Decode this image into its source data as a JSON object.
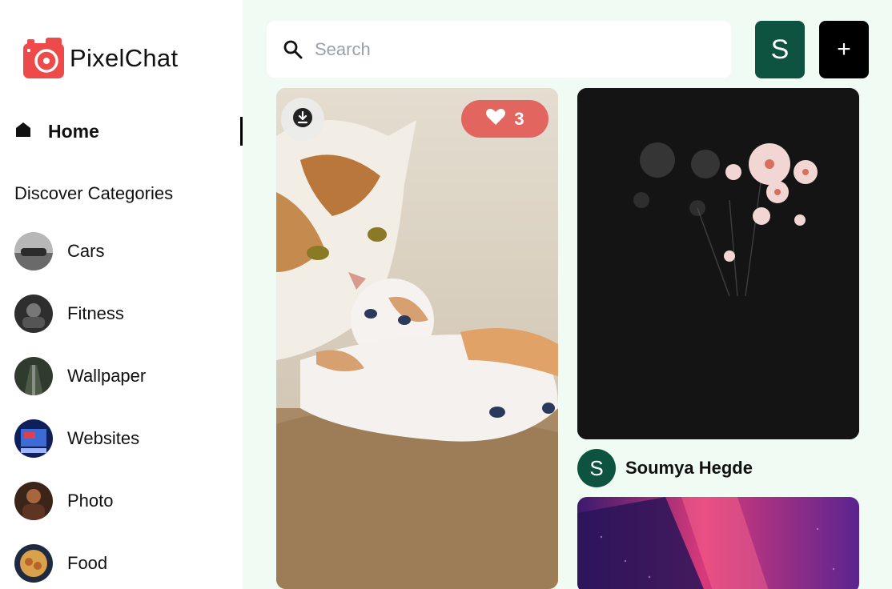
{
  "brand": {
    "name": "PixelChat",
    "accent": "#ee4a4a"
  },
  "nav": {
    "home_label": "Home"
  },
  "categories": {
    "heading": "Discover Categories",
    "items": [
      {
        "label": "Cars"
      },
      {
        "label": "Fitness"
      },
      {
        "label": "Wallpaper"
      },
      {
        "label": "Websites"
      },
      {
        "label": "Photo"
      },
      {
        "label": "Food"
      }
    ]
  },
  "search": {
    "placeholder": "Search",
    "value": ""
  },
  "header": {
    "user_initial": "S",
    "add_label": "+"
  },
  "pins": [
    {
      "image": "cat-with-kittens",
      "likes": "3"
    },
    {
      "image": "dark-flowers",
      "author_initial": "S",
      "author_name": "Soumya Hegde"
    },
    {
      "image": "purple-abstract"
    }
  ],
  "colors": {
    "background": "#f0fbf3",
    "user_green": "#0e5340",
    "like_red": "#e15550"
  }
}
